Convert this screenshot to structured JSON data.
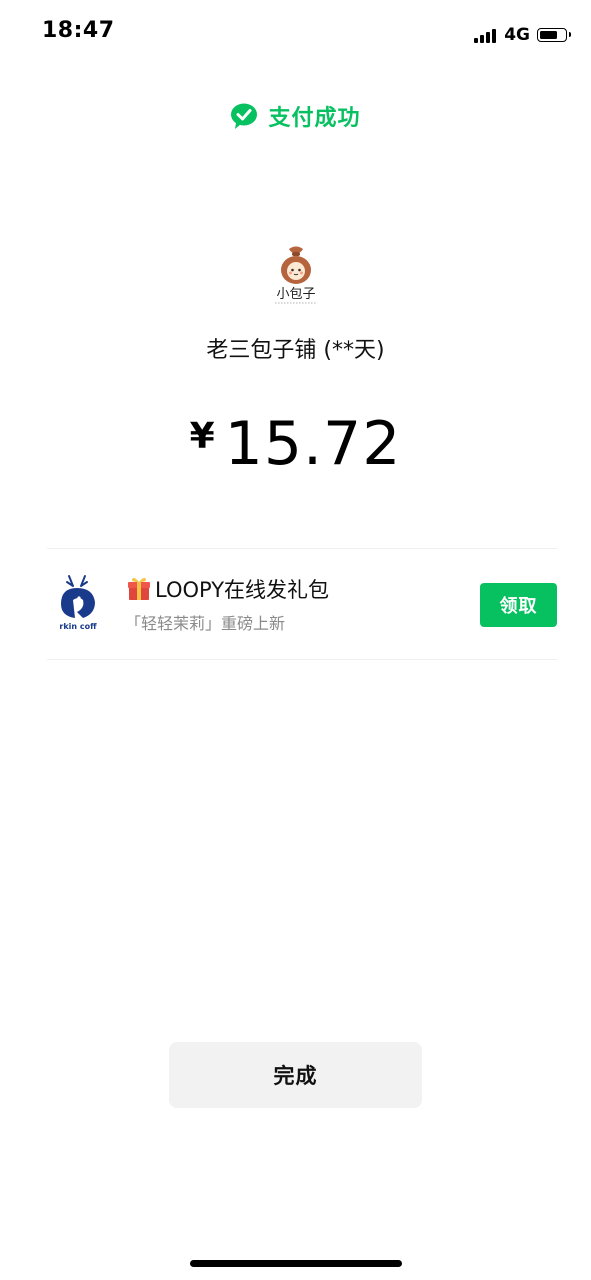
{
  "status_bar": {
    "time": "18:47",
    "network": "4G",
    "battery_level": 0.7
  },
  "header": {
    "status_text": "支付成功",
    "accent_color": "#07c160",
    "icon": "wechat-pay-success-icon"
  },
  "merchant": {
    "logo_text": "小包子",
    "name": "老三包子铺  (**天)"
  },
  "payment": {
    "currency": "¥",
    "amount": "15.72"
  },
  "promo": {
    "logo_text": "rkin coff",
    "title": "LOOPY在线发礼包",
    "subtitle": "「轻轻茉莉」重磅上新",
    "button_label": "领取",
    "icons": [
      "deer-logo-icon",
      "gift-icon"
    ]
  },
  "footer": {
    "done_label": "完成"
  }
}
